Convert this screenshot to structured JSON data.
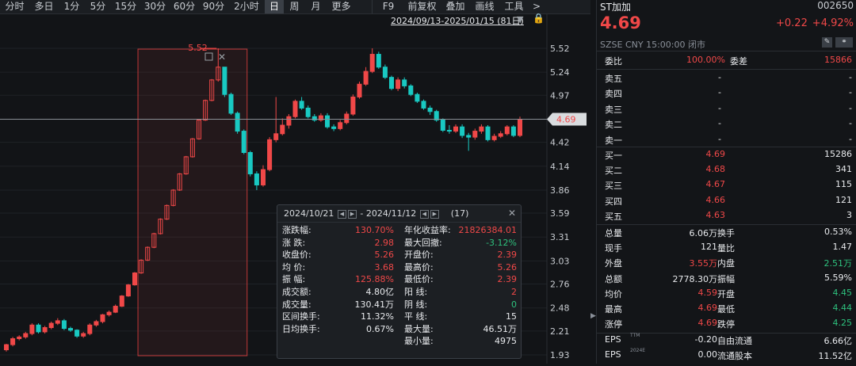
{
  "toolbar": {
    "items": [
      {
        "label": "分时",
        "w": 37
      },
      {
        "label": "多日",
        "w": 37
      },
      {
        "label": "1分",
        "w": 33
      },
      {
        "label": "5分",
        "w": 33
      },
      {
        "label": "15分",
        "w": 37
      },
      {
        "label": "30分",
        "w": 37
      },
      {
        "label": "60分",
        "w": 37
      },
      {
        "label": "90分",
        "w": 37
      },
      {
        "label": "2小时",
        "w": 46
      },
      {
        "label": "日",
        "w": 24
      },
      {
        "label": "周",
        "w": 27
      },
      {
        "label": "月",
        "w": 27
      },
      {
        "label": "更多",
        "w": 37
      },
      {
        "label": "F9",
        "w": 40
      },
      {
        "label": "前复权",
        "w": 47
      },
      {
        "label": "叠加",
        "w": 37
      },
      {
        "label": "画线",
        "w": 37
      },
      {
        "label": "工具",
        "w": 37
      },
      {
        "label": ">",
        "w": 20
      }
    ],
    "active": "日"
  },
  "range": {
    "label": "2024/09/13-2025/01/15 (81日)"
  },
  "chart": {
    "price_ticks": [
      "5.52",
      "5.24",
      "4.97",
      "4.69",
      "4.42",
      "4.14",
      "3.86",
      "3.59",
      "3.31",
      "3.03",
      "2.76",
      "2.48",
      "2.21",
      "1.93"
    ],
    "current_price": "4.69",
    "max_marker": "5.52"
  },
  "chart_data": {
    "type": "candlestick",
    "ylim": [
      1.93,
      5.52
    ],
    "open": [
      1.99,
      2.05,
      2.12,
      2.14,
      2.18,
      2.28,
      2.2,
      2.25,
      2.3,
      2.33,
      2.24,
      2.22,
      2.15,
      2.18,
      2.28,
      2.32,
      2.4,
      2.43,
      2.5,
      2.62,
      2.75,
      2.89,
      3.04,
      3.19,
      3.35,
      3.52,
      3.68,
      3.86,
      4.05,
      4.25,
      4.46,
      4.68,
      4.91,
      5.15,
      5.3,
      4.98,
      4.76,
      4.55,
      4.3,
      4.05,
      3.92,
      4.1,
      4.45,
      4.52,
      4.62,
      4.72,
      4.9,
      4.82,
      4.72,
      4.68,
      4.73,
      4.6,
      4.58,
      4.65,
      4.75,
      4.95,
      5.1,
      5.25,
      5.45,
      5.3,
      5.18,
      5.05,
      5.15,
      5.08,
      4.98,
      4.9,
      4.82,
      4.78,
      4.68,
      4.56,
      4.55,
      4.6,
      4.5,
      4.48,
      4.55,
      4.6,
      4.45,
      4.49,
      4.52,
      4.6,
      4.5
    ],
    "close": [
      2.05,
      2.12,
      2.14,
      2.18,
      2.28,
      2.2,
      2.25,
      2.3,
      2.33,
      2.24,
      2.22,
      2.15,
      2.18,
      2.28,
      2.32,
      2.4,
      2.43,
      2.5,
      2.62,
      2.75,
      2.89,
      3.04,
      3.19,
      3.35,
      3.52,
      3.68,
      3.86,
      4.05,
      4.25,
      4.46,
      4.68,
      4.91,
      5.15,
      5.3,
      4.98,
      4.76,
      4.55,
      4.3,
      4.05,
      3.92,
      4.1,
      4.45,
      4.52,
      4.62,
      4.72,
      4.9,
      4.82,
      4.72,
      4.68,
      4.73,
      4.6,
      4.58,
      4.65,
      4.75,
      4.95,
      5.1,
      5.25,
      5.45,
      5.3,
      5.18,
      5.05,
      5.15,
      5.08,
      4.98,
      4.9,
      4.82,
      4.78,
      4.68,
      4.56,
      4.55,
      4.6,
      4.5,
      4.48,
      4.55,
      4.6,
      4.45,
      4.49,
      4.52,
      4.6,
      4.5,
      4.69
    ],
    "high": [
      2.06,
      2.14,
      2.16,
      2.2,
      2.3,
      2.3,
      2.27,
      2.32,
      2.36,
      2.35,
      2.26,
      2.23,
      2.2,
      2.3,
      2.34,
      2.41,
      2.45,
      2.52,
      2.63,
      2.76,
      2.9,
      3.05,
      3.2,
      3.36,
      3.53,
      3.69,
      3.87,
      4.06,
      4.26,
      4.47,
      4.69,
      4.92,
      5.16,
      5.52,
      5.3,
      5.0,
      4.78,
      4.57,
      4.32,
      4.08,
      4.15,
      4.48,
      4.95,
      4.7,
      4.75,
      4.92,
      4.95,
      4.85,
      4.75,
      4.76,
      4.76,
      4.63,
      4.68,
      4.78,
      4.98,
      5.13,
      5.3,
      5.52,
      5.48,
      5.33,
      5.2,
      5.18,
      5.18,
      5.1,
      5.0,
      4.92,
      4.85,
      4.8,
      4.7,
      4.62,
      4.63,
      4.63,
      4.53,
      4.58,
      4.63,
      4.62,
      4.52,
      4.55,
      4.62,
      4.62,
      4.72
    ],
    "low": [
      1.97,
      2.03,
      2.1,
      2.12,
      2.16,
      2.18,
      2.18,
      2.23,
      2.28,
      2.22,
      2.2,
      2.13,
      2.13,
      2.16,
      2.26,
      2.3,
      2.38,
      2.42,
      2.49,
      2.61,
      2.74,
      2.88,
      3.03,
      3.18,
      3.34,
      3.51,
      3.67,
      3.85,
      4.04,
      4.24,
      4.45,
      4.67,
      4.9,
      5.13,
      4.95,
      4.74,
      4.52,
      4.28,
      4.02,
      3.86,
      3.9,
      4.08,
      4.42,
      4.5,
      4.58,
      4.7,
      4.8,
      4.7,
      4.66,
      4.66,
      4.58,
      4.55,
      4.56,
      4.63,
      4.73,
      4.93,
      5.08,
      5.23,
      5.28,
      5.16,
      5.03,
      5.02,
      5.05,
      4.96,
      4.88,
      4.8,
      4.74,
      4.66,
      4.54,
      4.52,
      4.53,
      4.47,
      4.32,
      4.45,
      4.52,
      4.43,
      4.43,
      4.47,
      4.5,
      4.48,
      4.48
    ]
  },
  "stats_popup": {
    "from": "2024/10/21",
    "to": "2024/11/12",
    "count": "(17)",
    "left": [
      {
        "label": "涨跌幅:",
        "value": "130.70%",
        "color": "red"
      },
      {
        "label": "涨    跌:",
        "value": "2.98",
        "color": "red"
      },
      {
        "label": "收盘价:",
        "value": "5.26",
        "color": "red"
      },
      {
        "label": "均    价:",
        "value": "3.68",
        "color": "red"
      },
      {
        "label": "振    幅:",
        "value": "125.88%",
        "color": "red"
      },
      {
        "label": "成交额:",
        "value": "4.80亿",
        "color": "white"
      },
      {
        "label": "成交量:",
        "value": "130.41万",
        "color": "white"
      },
      {
        "label": "区间换手:",
        "value": "11.32%",
        "color": "white"
      },
      {
        "label": "日均换手:",
        "value": "0.67%",
        "color": "white"
      }
    ],
    "right": [
      {
        "label": "年化收益率:",
        "value": "21826384.01",
        "color": "red"
      },
      {
        "label": "最大回撤:",
        "value": "-3.12%",
        "color": "green"
      },
      {
        "label": "开盘价:",
        "value": "2.39",
        "color": "red"
      },
      {
        "label": "最高价:",
        "value": "5.26",
        "color": "red"
      },
      {
        "label": "最低价:",
        "value": "2.39",
        "color": "red"
      },
      {
        "label": "阳    线:",
        "value": "2",
        "color": "red"
      },
      {
        "label": "阴    线:",
        "value": "0",
        "color": "green"
      },
      {
        "label": "平    线:",
        "value": "15",
        "color": "white"
      },
      {
        "label": "最大量:",
        "value": "46.51万",
        "color": "white"
      },
      {
        "label": "最小量:",
        "value": "4975",
        "color": "white"
      }
    ]
  },
  "quote": {
    "name": "ST加加",
    "code": "002650",
    "price": "4.69",
    "change": "+0.22",
    "change_pct": "+4.92%",
    "market_line": "SZSE  CNY  15:00:00  闭市",
    "weibi_label": "委比",
    "weibi": "100.00%",
    "weicha_label": "委差",
    "weicha": "15866",
    "sells": [
      {
        "label": "卖五",
        "price": "-",
        "vol": "-"
      },
      {
        "label": "卖四",
        "price": "-",
        "vol": "-"
      },
      {
        "label": "卖三",
        "price": "-",
        "vol": "-"
      },
      {
        "label": "卖二",
        "price": "-",
        "vol": "-"
      },
      {
        "label": "卖一",
        "price": "-",
        "vol": "-"
      }
    ],
    "buys": [
      {
        "label": "买一",
        "price": "4.69",
        "vol": "15286"
      },
      {
        "label": "买二",
        "price": "4.68",
        "vol": "341"
      },
      {
        "label": "买三",
        "price": "4.67",
        "vol": "115"
      },
      {
        "label": "买四",
        "price": "4.66",
        "vol": "121"
      },
      {
        "label": "买五",
        "price": "4.63",
        "vol": "3"
      }
    ],
    "details": [
      {
        "l1": "总量",
        "v1": "6.06万",
        "c1": "white",
        "l2": "换手",
        "v2": "0.53%",
        "c2": "white"
      },
      {
        "l1": "现手",
        "v1": "121",
        "c1": "white",
        "l2": "量比",
        "v2": "1.47",
        "c2": "white"
      },
      {
        "l1": "外盘",
        "v1": "3.55万",
        "c1": "red",
        "l2": "内盘",
        "v2": "2.51万",
        "c2": "green"
      },
      {
        "l1": "总额",
        "v1": "2778.30万",
        "c1": "white",
        "l2": "振幅",
        "v2": "5.59%",
        "c2": "white"
      },
      {
        "l1": "均价",
        "v1": "4.59",
        "c1": "red",
        "l2": "开盘",
        "v2": "4.45",
        "c2": "green"
      },
      {
        "l1": "最高",
        "v1": "4.69",
        "c1": "red",
        "l2": "最低",
        "v2": "4.44",
        "c2": "green"
      },
      {
        "l1": "涨停",
        "v1": "4.69",
        "c1": "red",
        "l2": "跌停",
        "v2": "4.25",
        "c2": "green"
      }
    ],
    "eps": [
      {
        "l1": "EPS",
        "sup": "TTM",
        "v1": "-0.20",
        "l2": "自由流通",
        "v2": "6.66亿"
      },
      {
        "l1": "EPS",
        "sup": "2024E",
        "v1": "0.00",
        "l2": "流通股本",
        "v2": "11.52亿"
      }
    ]
  },
  "colors": {
    "up": "#f04848",
    "down": "#19c9c2",
    "green": "#2ec27e",
    "bg": "#121417"
  }
}
